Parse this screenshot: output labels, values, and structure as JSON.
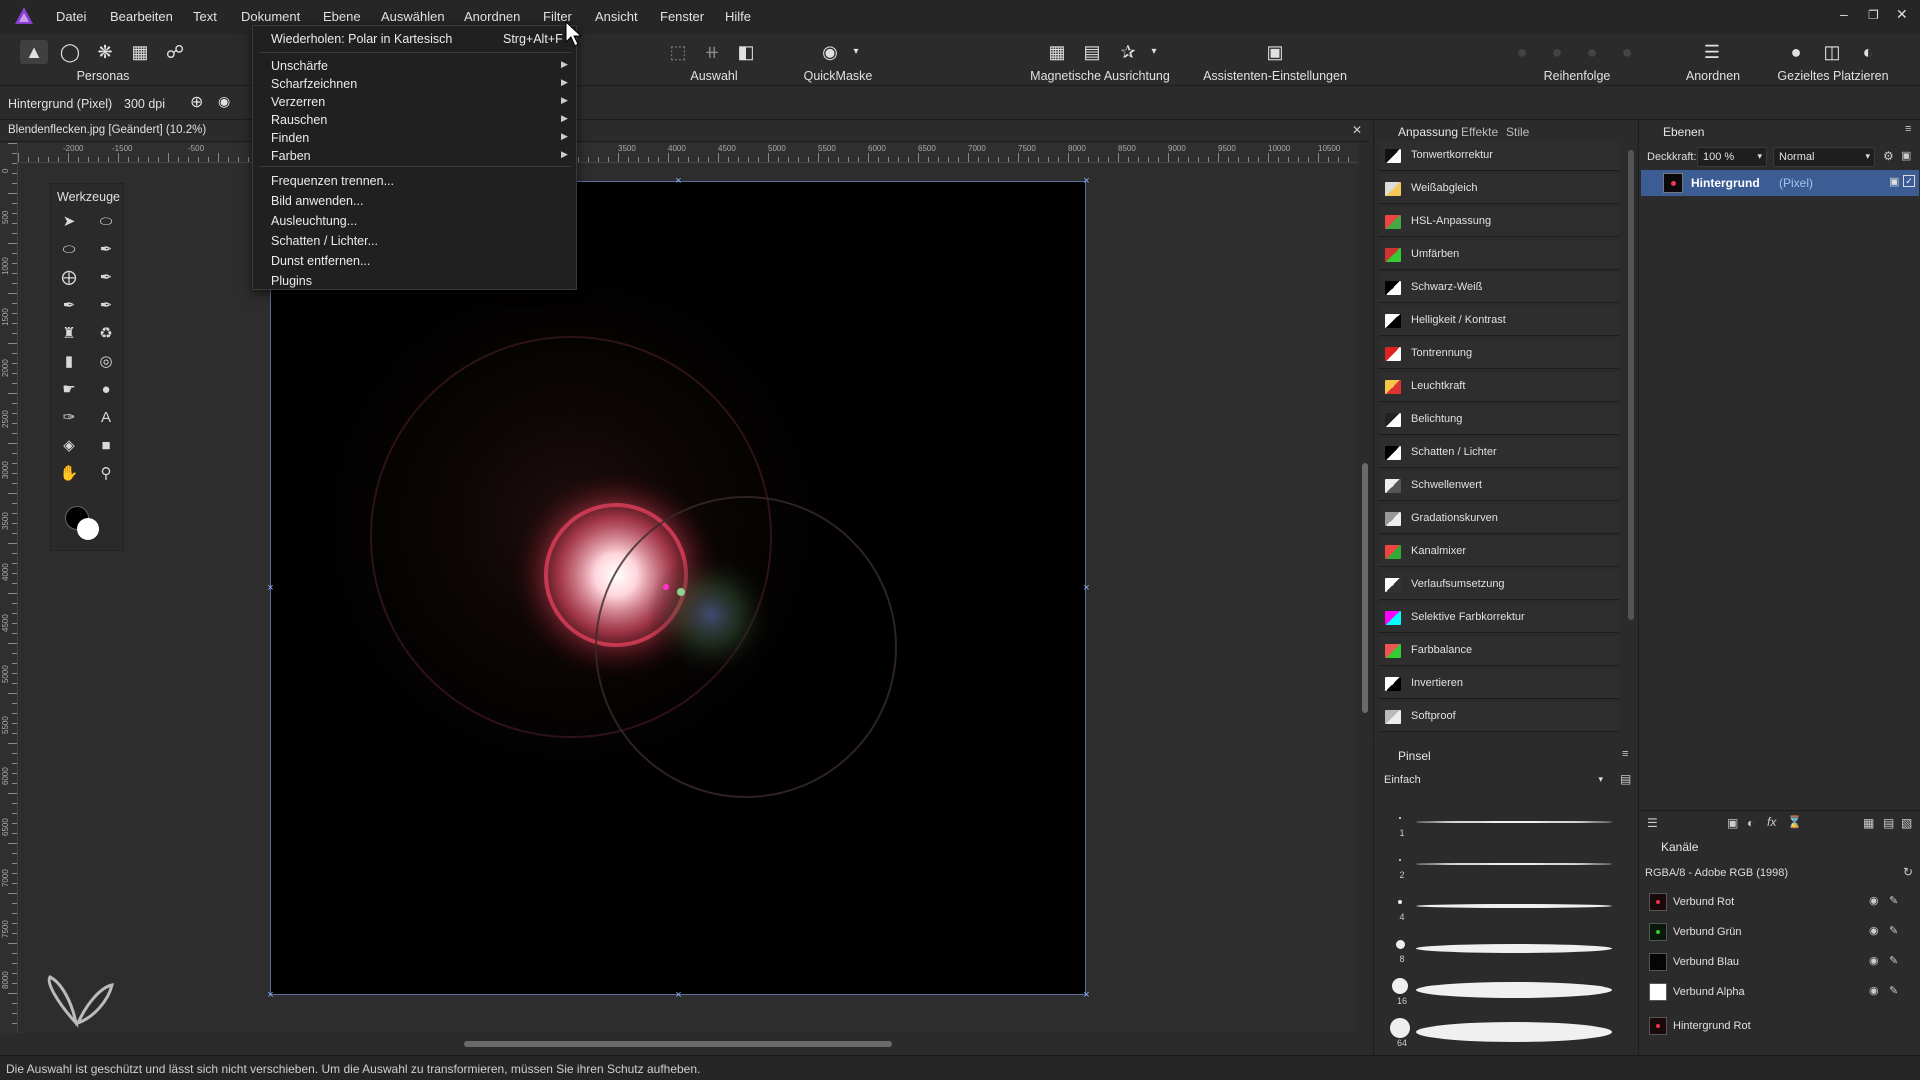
{
  "app": {
    "accent": "#3b5d94"
  },
  "menubar": {
    "items": [
      "Datei",
      "Bearbeiten",
      "Text",
      "Dokument",
      "Ebene",
      "Auswählen",
      "Anordnen",
      "Filter",
      "Ansicht",
      "Fenster",
      "Hilfe"
    ]
  },
  "filter_menu": {
    "repeat_label": "Wiederholen: Polar in Kartesisch",
    "repeat_shortcut": "Strg+Alt+F",
    "submenus": [
      "Unschärfe",
      "Scharfzeichnen",
      "Verzerren",
      "Rauschen",
      "Finden",
      "Farben"
    ],
    "actions": [
      "Frequenzen trennen...",
      "Bild anwenden...",
      "Ausleuchtung...",
      "Schatten / Lichter...",
      "Dunst entfernen...",
      "Plugins"
    ]
  },
  "toolbar": {
    "personas_label": "Personas",
    "auswahl_label": "Auswahl",
    "quickmask_label": "QuickMaske",
    "snapping_label": "Magnetische Ausrichtung",
    "assistant_label": "Assistenten-Einstellungen",
    "order_label": "Reihenfolge",
    "arrange_label": "Anordnen",
    "place_label": "Gezieltes Platzieren"
  },
  "context": {
    "layer_name": "Hintergrund (Pixel)",
    "dpi": "300 dpi"
  },
  "document": {
    "tab_title": "Blendenflecken.jpg [Geändert] (10.2%)"
  },
  "rulers": {
    "h_ticks": [
      "-2000",
      "-1500",
      "-500",
      "3500",
      "4000",
      "4500",
      "5000",
      "5500",
      "6000",
      "6500",
      "7000",
      "7500",
      "8000",
      "8500",
      "9000",
      "9500",
      "10000",
      "10500"
    ],
    "v_ticks": [
      "0",
      "500",
      "1000",
      "1500",
      "2000",
      "2500",
      "3000",
      "3500",
      "4000",
      "4500",
      "5000",
      "5500",
      "6000",
      "6500",
      "7000",
      "7500",
      "8000"
    ]
  },
  "tools": {
    "title": "Werkzeuge"
  },
  "adjustments": {
    "tabs": [
      "Anpassung",
      "Effekte",
      "Stile"
    ],
    "items": [
      "Tonwertkorrektur",
      "Weißabgleich",
      "HSL-Anpassung",
      "Umfärben",
      "Schwarz-Weiß",
      "Helligkeit / Kontrast",
      "Tontrennung",
      "Leuchtkraft",
      "Belichtung",
      "Schatten / Lichter",
      "Schwellenwert",
      "Gradationskurven",
      "Kanalmixer",
      "Verlaufsumsetzung",
      "Selektive Farbkorrektur",
      "Farbbalance",
      "Invertieren",
      "Softproof"
    ]
  },
  "brushes": {
    "title": "Pinsel",
    "category": "Einfach",
    "sizes": [
      "1",
      "2",
      "4",
      "8",
      "16",
      "64"
    ]
  },
  "layers": {
    "title": "Ebenen",
    "opacity_label": "Deckkraft:",
    "opacity_value": "100 %",
    "blend_mode": "Normal",
    "layer_name": "Hintergrund",
    "layer_type": "(Pixel)"
  },
  "channels": {
    "title": "Kanäle",
    "profile": "RGBA/8 - Adobe RGB (1998)",
    "items": [
      "Verbund Rot",
      "Verbund Grün",
      "Verbund Blau",
      "Verbund Alpha",
      "Hintergrund Rot"
    ]
  },
  "status": {
    "text": "Die Auswahl ist geschützt und lässt sich nicht verschieben. Um die Auswahl zu transformieren, müssen Sie ihren Schutz aufheben."
  }
}
